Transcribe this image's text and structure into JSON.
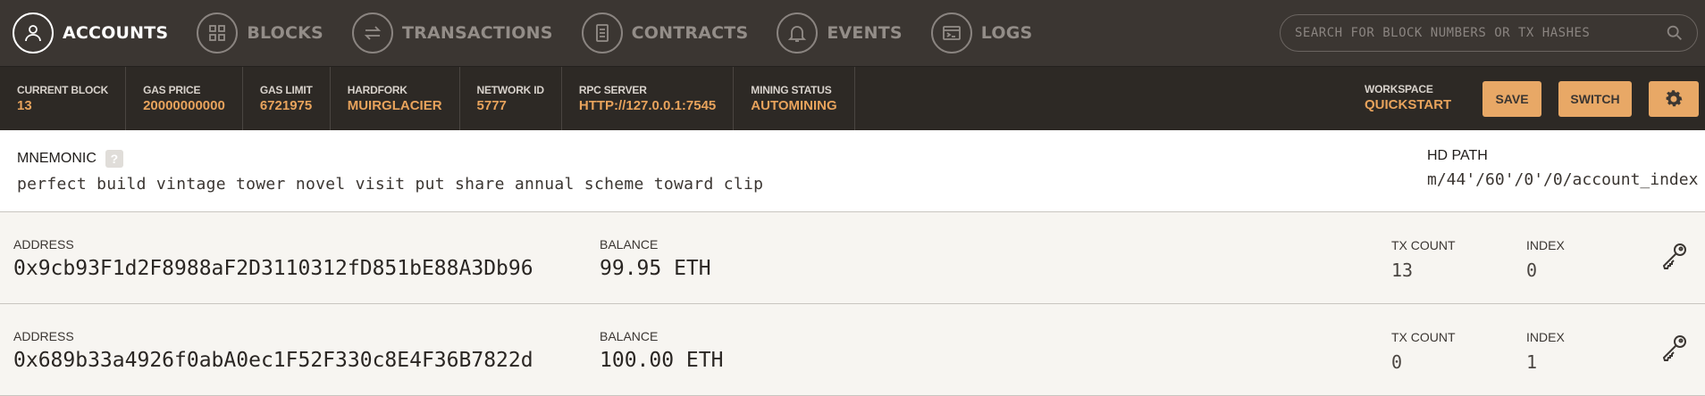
{
  "nav": {
    "items": [
      {
        "label": "ACCOUNTS",
        "icon": "person-icon",
        "active": true
      },
      {
        "label": "BLOCKS",
        "icon": "grid-icon",
        "active": false
      },
      {
        "label": "TRANSACTIONS",
        "icon": "swap-arrows-icon",
        "active": false
      },
      {
        "label": "CONTRACTS",
        "icon": "document-icon",
        "active": false
      },
      {
        "label": "EVENTS",
        "icon": "bell-icon",
        "active": false
      },
      {
        "label": "LOGS",
        "icon": "terminal-icon",
        "active": false
      }
    ],
    "search_placeholder": "SEARCH FOR BLOCK NUMBERS OR TX HASHES"
  },
  "status": {
    "current_block": {
      "label": "CURRENT BLOCK",
      "value": "13"
    },
    "gas_price": {
      "label": "GAS PRICE",
      "value": "20000000000"
    },
    "gas_limit": {
      "label": "GAS LIMIT",
      "value": "6721975"
    },
    "hardfork": {
      "label": "HARDFORK",
      "value": "MUIRGLACIER"
    },
    "network_id": {
      "label": "NETWORK ID",
      "value": "5777"
    },
    "rpc_server": {
      "label": "RPC SERVER",
      "value": "HTTP://127.0.0.1:7545"
    },
    "mining_status": {
      "label": "MINING STATUS",
      "value": "AUTOMINING"
    },
    "workspace": {
      "label": "WORKSPACE",
      "value": "QUICKSTART"
    },
    "save_label": "SAVE",
    "switch_label": "SWITCH"
  },
  "mnemonic": {
    "label": "MNEMONIC",
    "help": "?",
    "words": "perfect build vintage tower novel visit put share annual scheme toward clip",
    "hd_path_label": "HD PATH",
    "hd_path": "m/44'/60'/0'/0/account_index"
  },
  "accounts": [
    {
      "address_label": "ADDRESS",
      "address": "0x9cb93F1d2F8988aF2D3110312fD851bE88A3Db96",
      "balance_label": "BALANCE",
      "balance": "99.95 ETH",
      "tx_count_label": "TX COUNT",
      "tx_count": "13",
      "index_label": "INDEX",
      "index": "0"
    },
    {
      "address_label": "ADDRESS",
      "address": "0x689b33a4926f0abA0ec1F52F330c8E4F36B7822d",
      "balance_label": "BALANCE",
      "balance": "100.00 ETH",
      "tx_count_label": "TX COUNT",
      "tx_count": "0",
      "index_label": "INDEX",
      "index": "1"
    }
  ],
  "colors": {
    "nav_bg": "#3b3632",
    "status_bg": "#2d2925",
    "accent": "#e8a35c",
    "button_bg": "#e8a866"
  }
}
